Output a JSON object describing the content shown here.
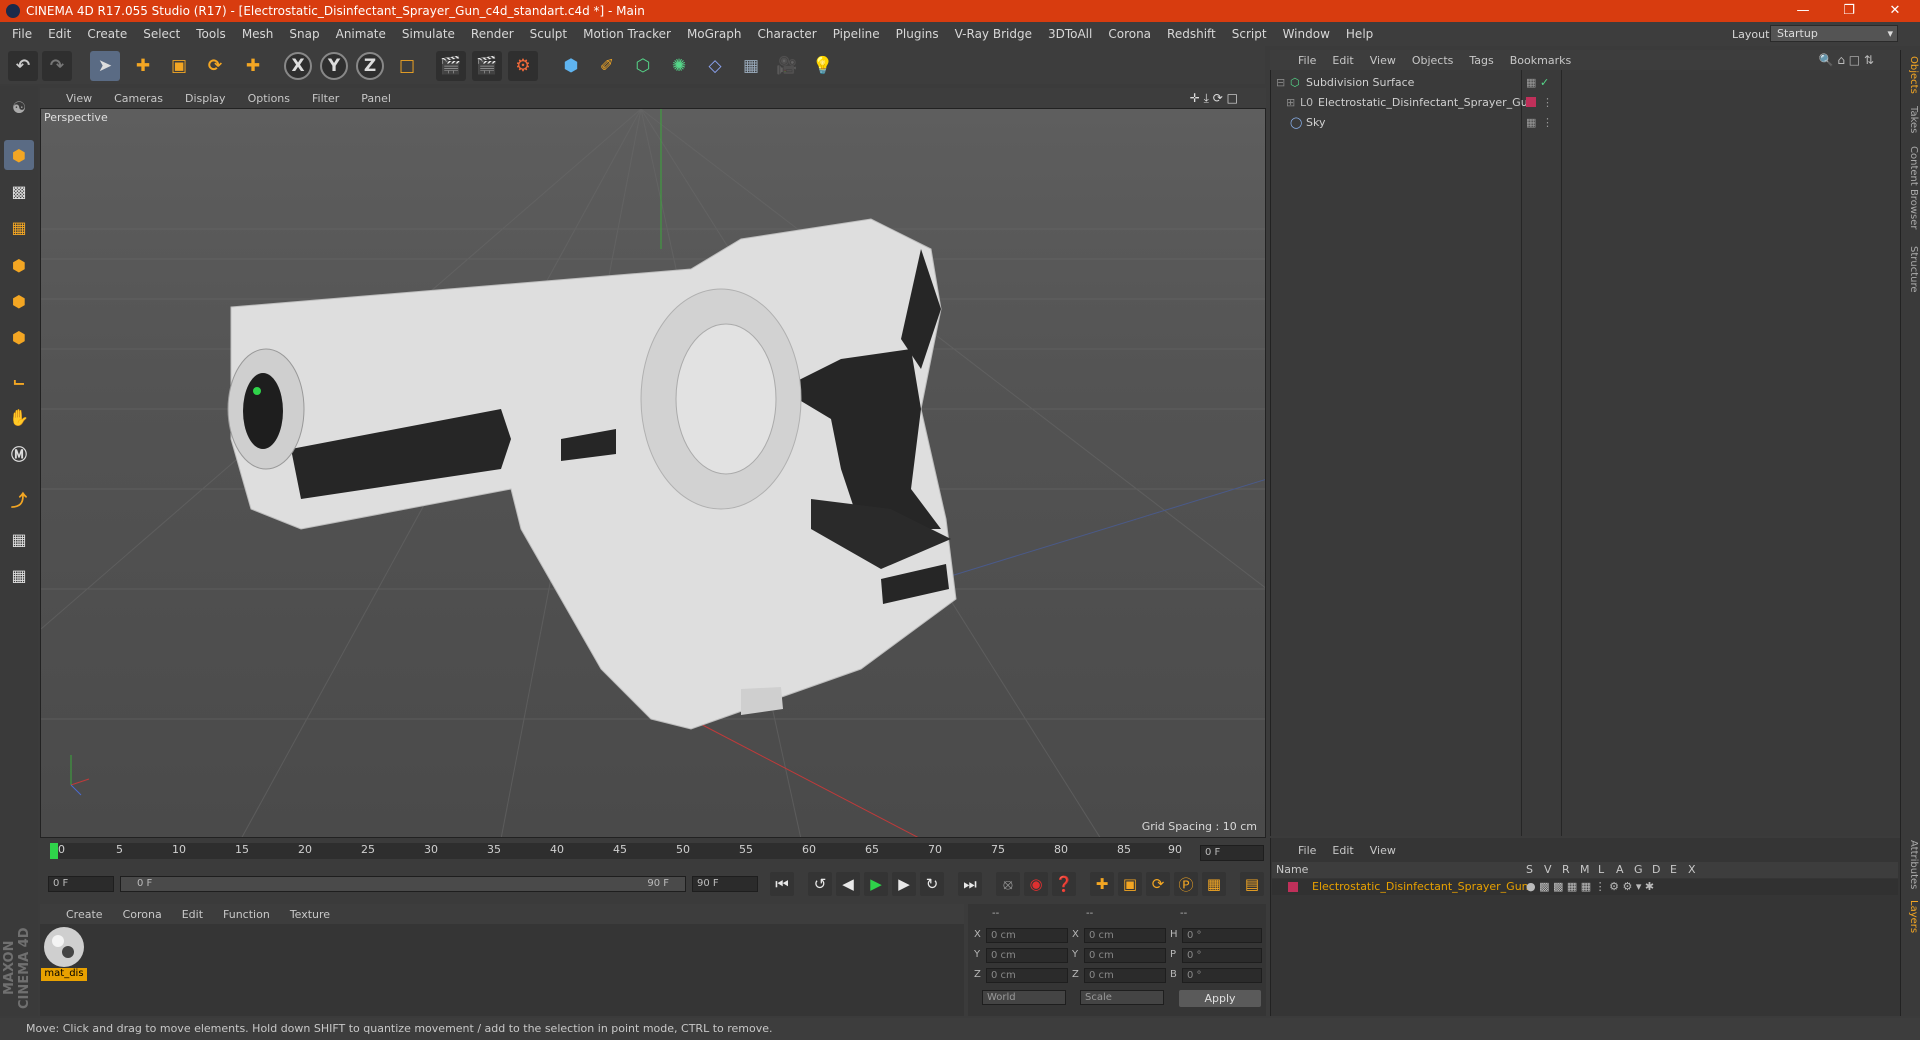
{
  "window": {
    "title": "CINEMA 4D R17.055 Studio (R17) - [Electrostatic_Disinfectant_Sprayer_Gun_c4d_standart.c4d *] - Main"
  },
  "menu": [
    "File",
    "Edit",
    "Create",
    "Select",
    "Tools",
    "Mesh",
    "Snap",
    "Animate",
    "Simulate",
    "Render",
    "Sculpt",
    "Motion Tracker",
    "MoGraph",
    "Character",
    "Pipeline",
    "Plugins",
    "V-Ray Bridge",
    "3DToAll",
    "Corona",
    "Redshift",
    "Script",
    "Window",
    "Help"
  ],
  "layout": {
    "label": "Layout:",
    "value": "Startup"
  },
  "toolbar": {
    "axes": [
      "X",
      "Y",
      "Z"
    ]
  },
  "viewport": {
    "menu": [
      "View",
      "Cameras",
      "Display",
      "Options",
      "Filter",
      "Panel"
    ],
    "label": "Perspective",
    "grid_spacing": "Grid Spacing : 10 cm"
  },
  "timeline": {
    "ticks": [
      "0",
      "5",
      "10",
      "15",
      "20",
      "25",
      "30",
      "35",
      "40",
      "45",
      "50",
      "55",
      "60",
      "65",
      "70",
      "75",
      "80",
      "85",
      "90"
    ],
    "frame": "0 F",
    "start": "0 F",
    "range_start": "0 F",
    "range_end": "90 F",
    "end": "90 F"
  },
  "materials": {
    "menu": [
      "Create",
      "Corona",
      "Edit",
      "Function",
      "Texture"
    ],
    "items": [
      {
        "name": "mat_dis"
      }
    ]
  },
  "coords": {
    "headers": [
      "--",
      "--",
      "--"
    ],
    "rows": [
      {
        "a": "X",
        "av": "0 cm",
        "b": "X",
        "bv": "0 cm",
        "c": "H",
        "cv": "0 °"
      },
      {
        "a": "Y",
        "av": "0 cm",
        "b": "Y",
        "bv": "0 cm",
        "c": "P",
        "cv": "0 °"
      },
      {
        "a": "Z",
        "av": "0 cm",
        "b": "Z",
        "bv": "0 cm",
        "c": "B",
        "cv": "0 °"
      }
    ],
    "world": "World",
    "scale": "Scale",
    "apply": "Apply"
  },
  "status": "Move: Click and drag to move elements. Hold down SHIFT to quantize movement / add to the selection in point mode, CTRL to remove.",
  "objects": {
    "menu": [
      "File",
      "Edit",
      "View",
      "Objects",
      "Tags",
      "Bookmarks"
    ],
    "items": [
      {
        "name": "Subdivision Surface"
      },
      {
        "name": "Electrostatic_Disinfectant_Sprayer_Gun"
      },
      {
        "name": "Sky"
      }
    ]
  },
  "layers": {
    "menu": [
      "File",
      "Edit",
      "View"
    ],
    "header_name": "Name",
    "columns": [
      "S",
      "V",
      "R",
      "M",
      "L",
      "A",
      "G",
      "D",
      "E",
      "X"
    ],
    "items": [
      {
        "name": "Electrostatic_Disinfectant_Sprayer_Gun"
      }
    ]
  },
  "sidetabs": [
    "Objects",
    "Takes",
    "Content Browser",
    "Structure",
    "Attributes",
    "Layers"
  ],
  "brand": "MAXON CINEMA 4D",
  "colors": {
    "titlebar": "#d83c0f",
    "accent": "#e8a100",
    "layer": "#c0305a"
  }
}
